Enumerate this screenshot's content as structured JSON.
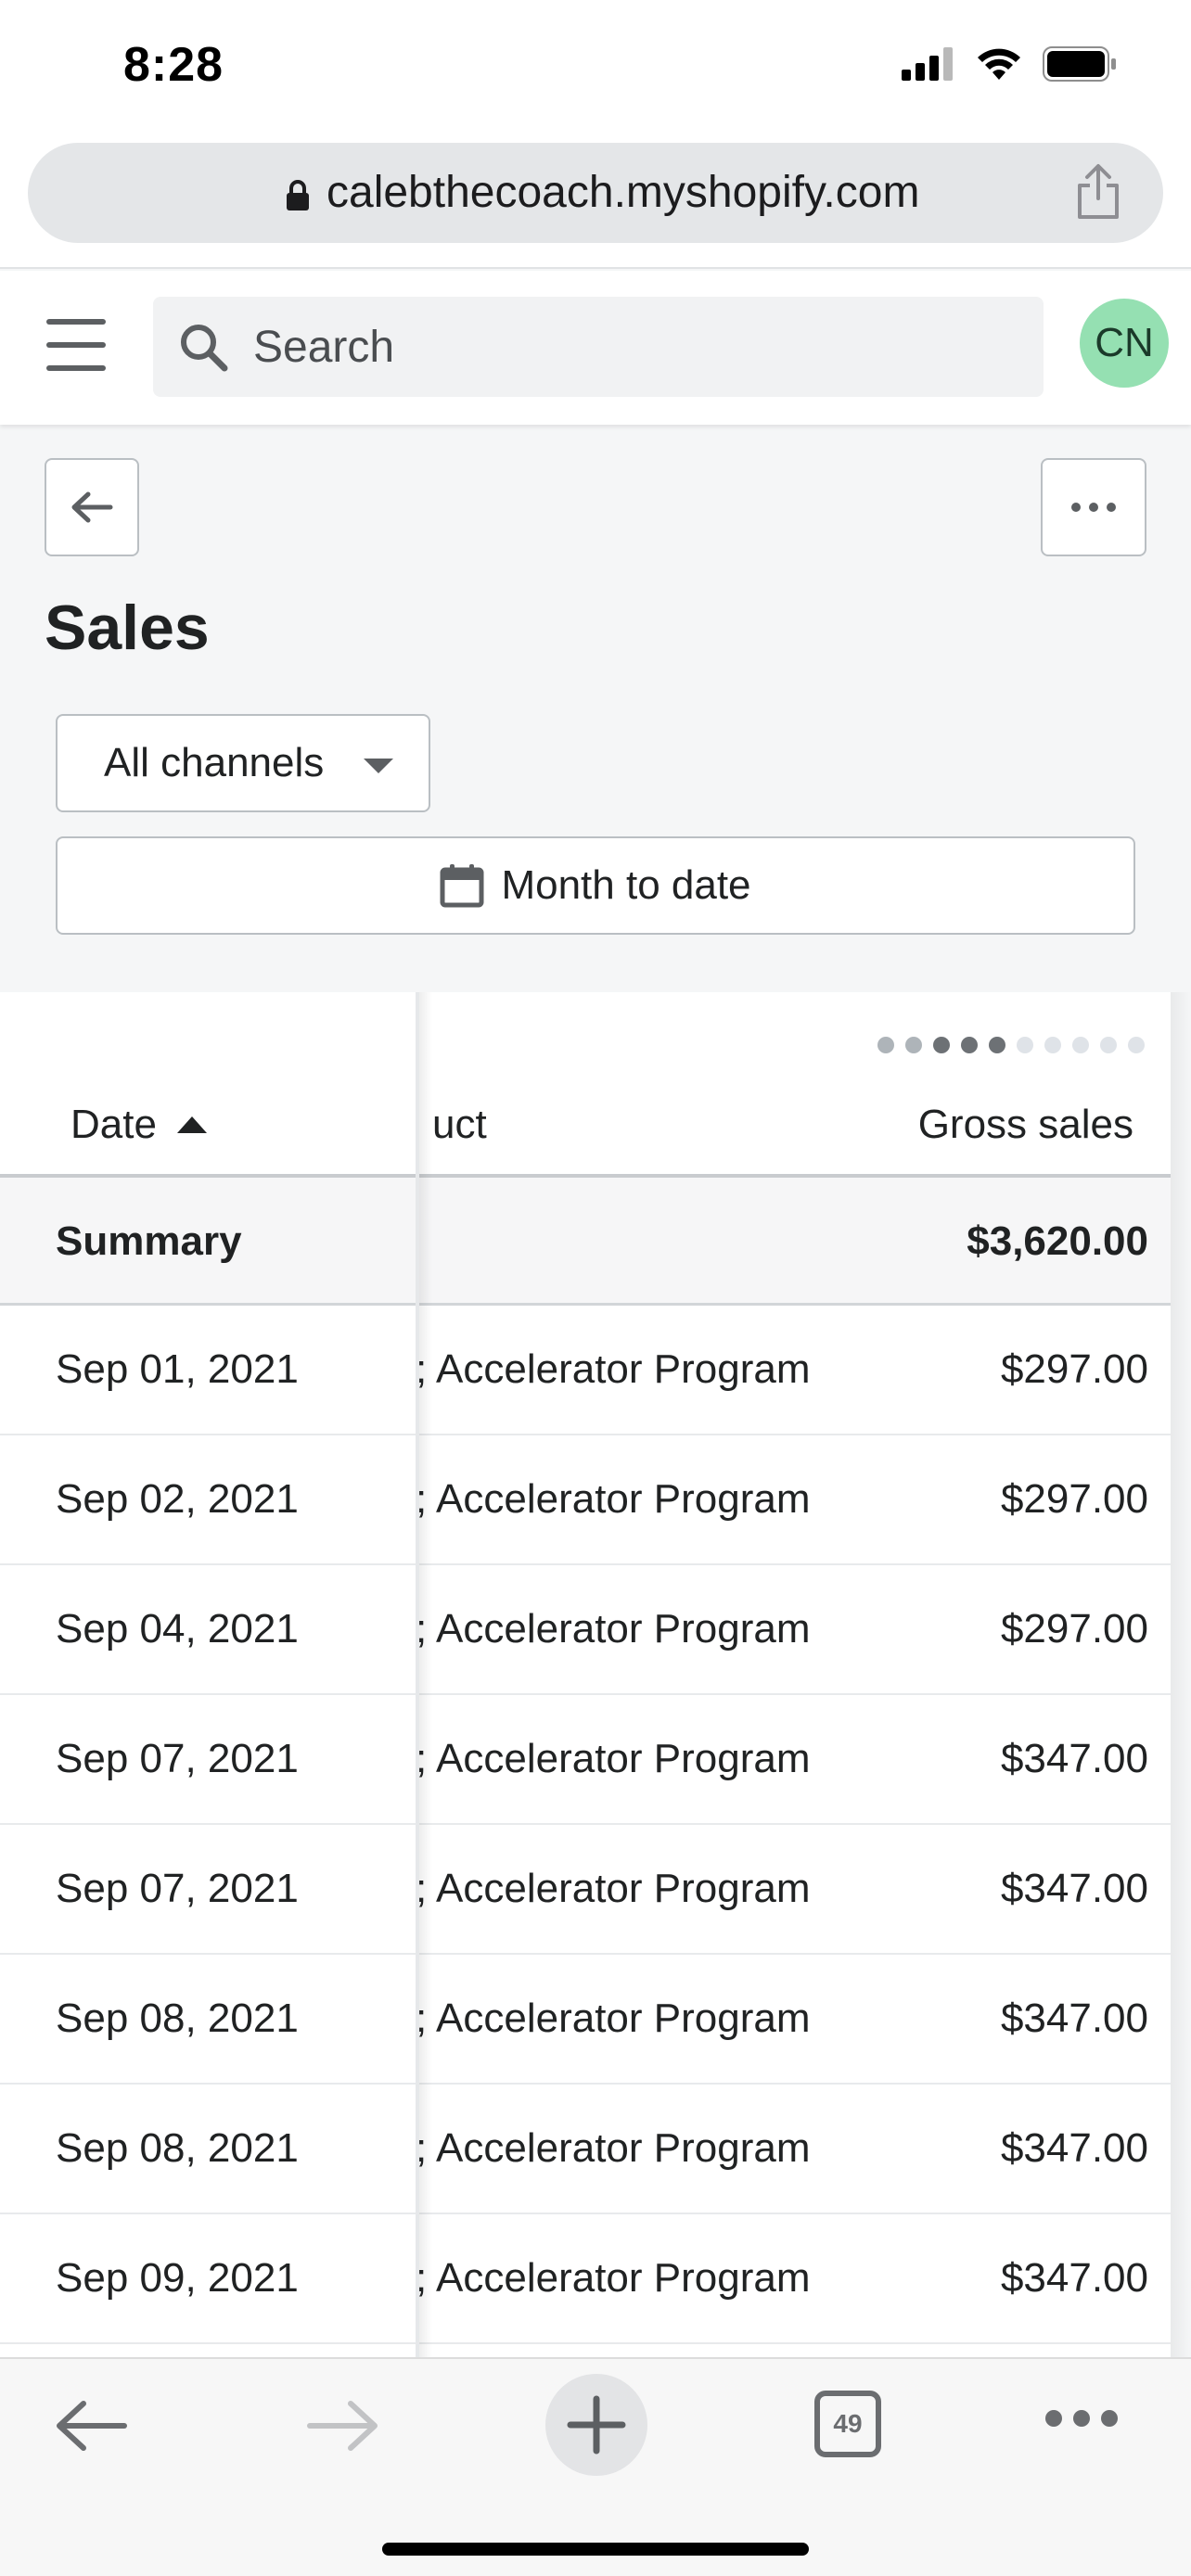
{
  "status_bar": {
    "time": "8:28"
  },
  "browser": {
    "url": "calebthecoach.myshopify.com",
    "tab_count": "49"
  },
  "header": {
    "search_placeholder": "Search",
    "avatar_initials": "CN"
  },
  "page": {
    "title": "Sales",
    "channel_filter": "All channels",
    "date_range": "Month to date"
  },
  "table": {
    "columns": {
      "date": "Date",
      "product": "uct",
      "gross_sales": "Gross sales"
    },
    "summary": {
      "label": "Summary",
      "gross_sales": "$3,620.00"
    },
    "rows": [
      {
        "date": "Sep 01, 2021",
        "product": "; Accelerator Program",
        "gross_sales": "$297.00"
      },
      {
        "date": "Sep 02, 2021",
        "product": "; Accelerator Program",
        "gross_sales": "$297.00"
      },
      {
        "date": "Sep 04, 2021",
        "product": "; Accelerator Program",
        "gross_sales": "$297.00"
      },
      {
        "date": "Sep 07, 2021",
        "product": "; Accelerator Program",
        "gross_sales": "$347.00"
      },
      {
        "date": "Sep 07, 2021",
        "product": "; Accelerator Program",
        "gross_sales": "$347.00"
      },
      {
        "date": "Sep 08, 2021",
        "product": "; Accelerator Program",
        "gross_sales": "$347.00"
      },
      {
        "date": "Sep 08, 2021",
        "product": "; Accelerator Program",
        "gross_sales": "$347.00"
      },
      {
        "date": "Sep 09, 2021",
        "product": "; Accelerator Program",
        "gross_sales": "$347.00"
      }
    ],
    "pagination": {
      "total_dots": 10,
      "active_dots": [
        2,
        3,
        4
      ],
      "mid_dots": [
        0,
        1
      ]
    }
  },
  "icons": {
    "lock": "lock-icon",
    "share": "share-icon",
    "menu": "hamburger-icon",
    "search": "search-icon",
    "back": "arrow-left-icon",
    "more": "ellipsis-icon",
    "calendar": "calendar-icon",
    "sort": "sort-ascending-icon"
  },
  "colors": {
    "avatar_bg": "#95e0b2",
    "border": "#babfc3",
    "text": "#202223"
  }
}
